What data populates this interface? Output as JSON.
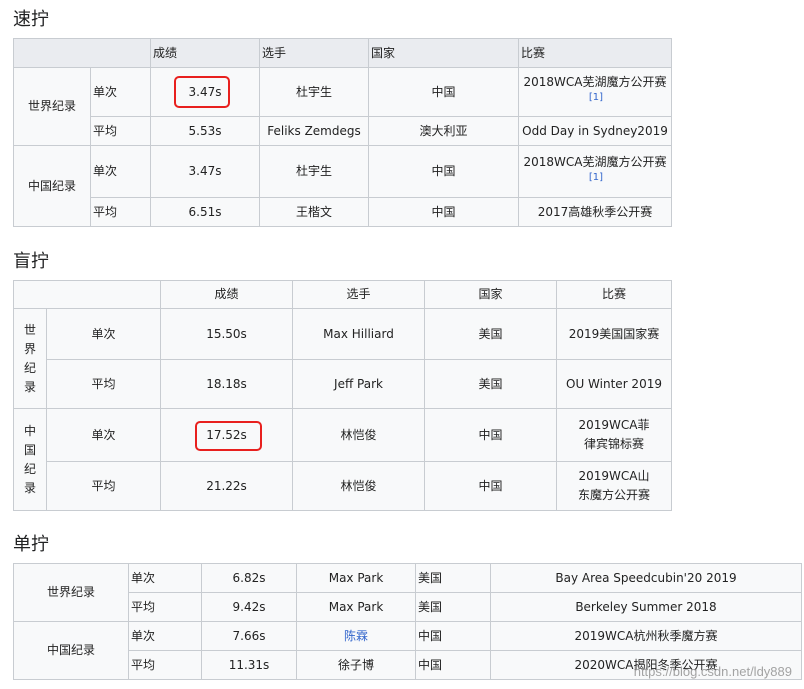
{
  "headings": {
    "speed": "速拧",
    "blind": "盲拧",
    "one_handed": "单拧"
  },
  "columns": {
    "result": "成绩",
    "player": "选手",
    "country": "国家",
    "competition": "比赛"
  },
  "speed": {
    "world": {
      "label": "世界纪录",
      "single": {
        "type": "单次",
        "result": "3.47s",
        "player": "杜宇生",
        "country": "中国",
        "competition": "2018WCA芜湖魔方公开赛",
        "cite": "[1]"
      },
      "average": {
        "type": "平均",
        "result": "5.53s",
        "player": "Feliks Zemdegs",
        "country": "澳大利亚",
        "competition": "Odd Day in Sydney2019"
      }
    },
    "china": {
      "label": "中国纪录",
      "single": {
        "type": "单次",
        "result": "3.47s",
        "player": "杜宇生",
        "country": "中国",
        "competition": "2018WCA芜湖魔方公开赛",
        "cite": "[1]"
      },
      "average": {
        "type": "平均",
        "result": "6.51s",
        "player": "王楷文",
        "country": "中国",
        "competition": "2017高雄秋季公开赛"
      }
    }
  },
  "blind": {
    "world": {
      "label_chars": [
        "世",
        "界",
        "纪",
        "录"
      ],
      "single": {
        "type": "单次",
        "result": "15.50s",
        "player": "Max Hilliard",
        "country": "美国",
        "competition": "2019美国国家赛"
      },
      "average": {
        "type": "平均",
        "result": "18.18s",
        "player": "Jeff Park",
        "country": "美国",
        "competition": "OU Winter 2019"
      }
    },
    "china": {
      "label_chars": [
        "中",
        "国",
        "纪",
        "录"
      ],
      "single": {
        "type": "单次",
        "result": "17.52s",
        "player": "林恺俊",
        "country": "中国",
        "competition": "2019WCA菲律宾锦标赛"
      },
      "average": {
        "type": "平均",
        "result": "21.22s",
        "player": "林恺俊",
        "country": "中国",
        "competition": "2019WCA山东魔方公开赛"
      }
    }
  },
  "one_handed": {
    "world": {
      "label": "世界纪录",
      "single": {
        "type": "单次",
        "result": "6.82s",
        "player": "Max Park",
        "country": "美国",
        "competition": "Bay Area Speedcubin'20 2019"
      },
      "average": {
        "type": "平均",
        "result": "9.42s",
        "player": "Max Park",
        "country": "美国",
        "competition": "Berkeley Summer 2018"
      }
    },
    "china": {
      "label": "中国纪录",
      "single": {
        "type": "单次",
        "result": "7.66s",
        "player": "陈霖",
        "country": "中国",
        "competition": "2019WCA杭州秋季魔方赛"
      },
      "average": {
        "type": "平均",
        "result": "11.31s",
        "player": "徐子博",
        "country": "中国",
        "competition": "2020WCA揭阳冬季公开赛"
      }
    }
  },
  "watermark": "https://blog.csdn.net/ldy889",
  "colors": {
    "highlight": "#e8201e",
    "link": "#3366cc",
    "border": "#c8ccd1",
    "header_bg": "#eaecf0"
  }
}
